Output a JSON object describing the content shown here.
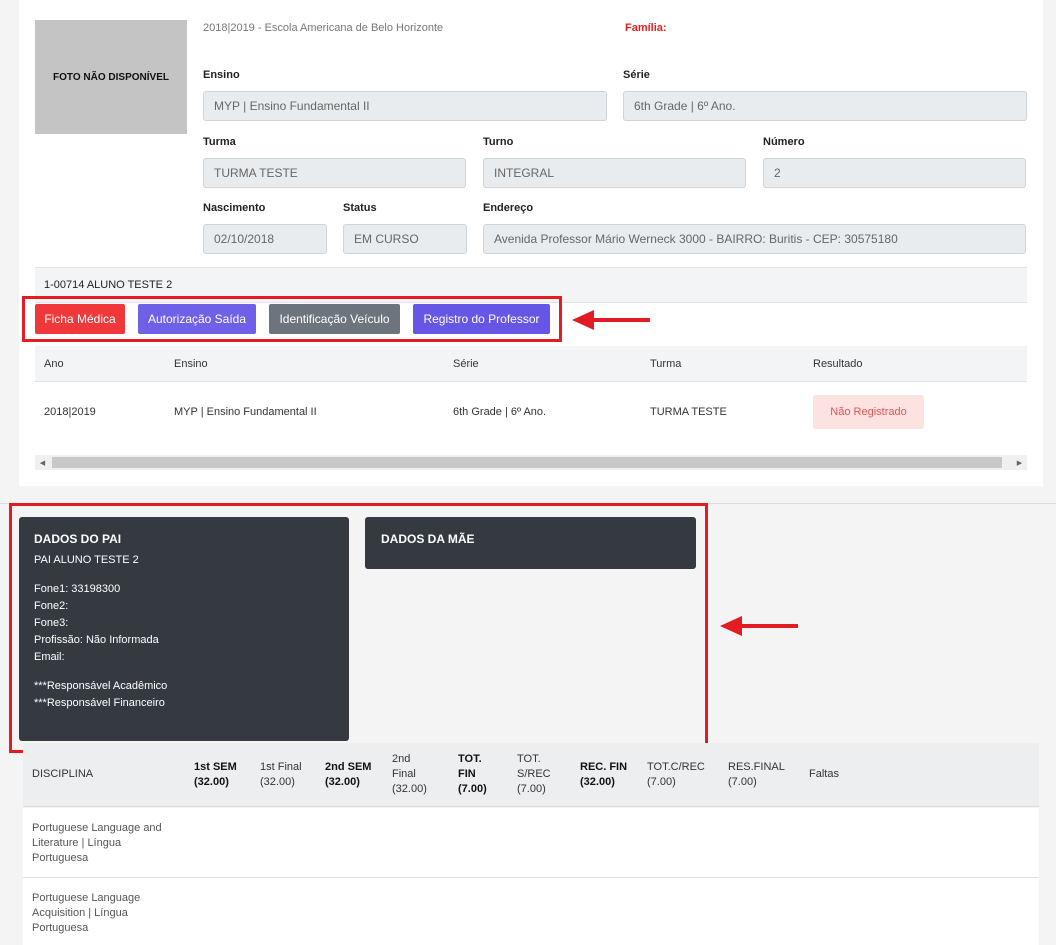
{
  "photo": {
    "text": "FOTO NÃO DISPONÍVEL"
  },
  "header": {
    "school_year": "2018|2019 - Escola Americana de Belo Horizonte",
    "familia_label": "Família:"
  },
  "fields": {
    "ensino": {
      "label": "Ensino",
      "value": "MYP | Ensino Fundamental II"
    },
    "serie": {
      "label": "Série",
      "value": "6th Grade | 6º Ano."
    },
    "turma": {
      "label": "Turma",
      "value": "TURMA TESTE"
    },
    "turno": {
      "label": "Turno",
      "value": "INTEGRAL"
    },
    "numero": {
      "label": "Número",
      "value": "2"
    },
    "nascimento": {
      "label": "Nascimento",
      "value": "02/10/2018"
    },
    "status": {
      "label": "Status",
      "value": "EM CURSO"
    },
    "endereco": {
      "label": "Endereço",
      "value": "Avenida Professor Mário Werneck 3000  - BAIRRO: Buritis - CEP: 30575180"
    }
  },
  "student": {
    "id_name": "1-00714 ALUNO TESTE 2"
  },
  "buttons": {
    "ficha_medica": "Ficha Médica",
    "autorizacao_saida": "Autorização Saída",
    "identificacao_veiculo": "Identificação Veículo",
    "registro_professor": "Registro do Professor"
  },
  "history_table": {
    "headers": [
      "Ano",
      "Ensino",
      "Série",
      "Turma",
      "Resultado"
    ],
    "rows": [
      {
        "ano": "2018|2019",
        "ensino": "MYP | Ensino Fundamental II",
        "serie": "6th Grade | 6º Ano.",
        "turma": "TURMA TESTE",
        "resultado": "Não Registrado"
      }
    ]
  },
  "pai": {
    "title": "DADOS DO PAI",
    "name": "PAI ALUNO TESTE 2",
    "fone1": "Fone1: 33198300",
    "fone2": "Fone2:",
    "fone3": "Fone3:",
    "profissao": "Profissão: Não Informada",
    "email": "Email:",
    "resp_academico": "***Responsável Acadêmico",
    "resp_financeiro": "***Responsável Financeiro"
  },
  "mae": {
    "title": "DADOS DA MÃE"
  },
  "grades": {
    "headers": {
      "disciplina": "DISCIPLINA",
      "sem1_a": "1st SEM",
      "sem1_b": "(32.00)",
      "final1_a": "1st Final",
      "final1_b": "(32.00)",
      "sem2_a": "2nd SEM",
      "sem2_b": "(32.00)",
      "final2_a": "2nd",
      "final2_b": "Final",
      "final2_c": "(32.00)",
      "totfin_a": "TOT.",
      "totfin_b": "FIN",
      "totfin_c": "(7.00)",
      "totsrec_a": "TOT.",
      "totsrec_b": "S/REC",
      "totsrec_c": "(7.00)",
      "recfin_a": "REC. FIN",
      "recfin_b": "(32.00)",
      "totcrec_a": "TOT.C/REC",
      "totcrec_b": "(7.00)",
      "resfinal_a": "RES.FINAL",
      "resfinal_b": "(7.00)",
      "faltas": "Faltas"
    },
    "rows": [
      {
        "l1": "Portuguese Language and",
        "l2": "Literature | Língua",
        "l3": "Portuguesa"
      },
      {
        "l1": "Portuguese Language",
        "l2": "Acquisition | Língua",
        "l3": "Portuguesa"
      }
    ]
  },
  "colors": {
    "annotation": "#e31b23",
    "ficha_btn": "#f0383b",
    "autorizacao_btn": "#6f60e8",
    "identificacao_btn": "#6c757d",
    "registro_btn": "#6556e6",
    "dark_card": "#343a40"
  }
}
